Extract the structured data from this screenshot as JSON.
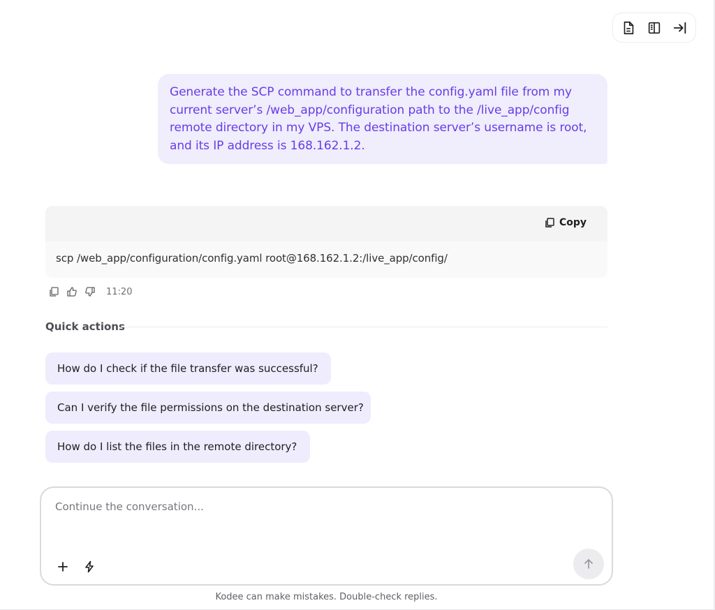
{
  "toolbar": {
    "icons": [
      "document-icon",
      "split-view-icon",
      "collapse-right-icon"
    ]
  },
  "user_message": {
    "text": "Generate the SCP command to transfer the config.yaml file from my current server’s /web_app/configuration path to the /live_app/config remote directory in my VPS. The destination server’s username is root, and its IP address is 168.162.1.2."
  },
  "assistant_message": {
    "copy_label": "Copy",
    "code": "scp /web_app/configuration/config.yaml root@168.162.1.2:/live_app/config/",
    "time": "11:20"
  },
  "quick_actions": {
    "title": "Quick actions",
    "items": [
      "How do I check if the file transfer was successful?",
      "Can I verify the file permissions on the destination server?",
      "How do I list the files in the remote directory?"
    ]
  },
  "composer": {
    "placeholder": "Continue the conversation..."
  },
  "footer": {
    "disclaimer": "Kodee can make mistakes. Double-check replies."
  },
  "colors": {
    "accent": "#673de6",
    "user_bubble_bg": "#f0edfc",
    "chip_bg": "#efecfd"
  }
}
